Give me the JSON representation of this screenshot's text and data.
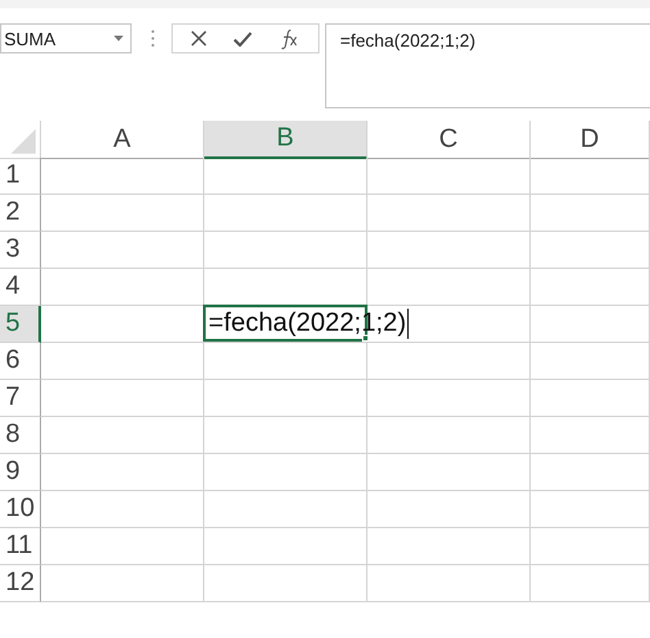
{
  "name_box": {
    "value": "SUMA"
  },
  "formula_bar": {
    "value": "=fecha(2022;1;2)"
  },
  "columns": [
    {
      "label": "A",
      "selected": false
    },
    {
      "label": "B",
      "selected": true
    },
    {
      "label": "C",
      "selected": false
    },
    {
      "label": "D",
      "selected": false
    }
  ],
  "rows": [
    {
      "label": "1",
      "selected": false
    },
    {
      "label": "2",
      "selected": false
    },
    {
      "label": "3",
      "selected": false
    },
    {
      "label": "4",
      "selected": false
    },
    {
      "label": "5",
      "selected": true,
      "cell": {
        "value": "=fecha(2022;1;2)",
        "editing": true
      }
    },
    {
      "label": "6",
      "selected": false
    },
    {
      "label": "7",
      "selected": false
    },
    {
      "label": "8",
      "selected": false
    },
    {
      "label": "9",
      "selected": false
    },
    {
      "label": "10",
      "selected": false
    },
    {
      "label": "11",
      "selected": false
    },
    {
      "label": "12",
      "selected": false
    }
  ]
}
